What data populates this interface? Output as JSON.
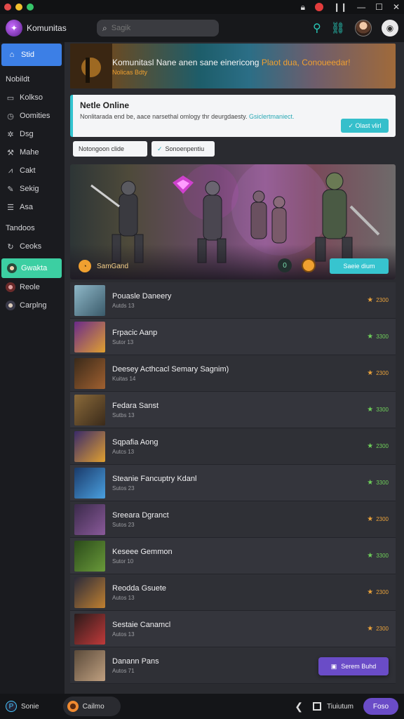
{
  "window": {
    "traffic_colors": [
      "#e24b4b",
      "#f2c02e",
      "#36c56a"
    ]
  },
  "header": {
    "app_title": "Komunitas",
    "search_placeholder": "Sagik"
  },
  "sidebar": {
    "active": "Stid",
    "section1": "Nobildt",
    "items1": [
      {
        "label": "Kolkso",
        "icon": "folder-icon",
        "glyph": "▭"
      },
      {
        "label": "Oomities",
        "icon": "clock-icon",
        "glyph": "◷"
      },
      {
        "label": "Dsg",
        "icon": "gear-icon",
        "glyph": "✲"
      },
      {
        "label": "Mahe",
        "icon": "wrench-icon",
        "glyph": "⚒"
      },
      {
        "label": "Cakt",
        "icon": "chart-icon",
        "glyph": "⩘"
      },
      {
        "label": "Sekig",
        "icon": "pen-icon",
        "glyph": "✎"
      },
      {
        "label": "Asa",
        "icon": "list-icon",
        "glyph": "☰"
      }
    ],
    "section2": "Tandoos",
    "items2": [
      {
        "label": "Ceoks",
        "icon": "refresh-icon",
        "glyph": "↻"
      }
    ],
    "active2": "Gwakta",
    "items3": [
      {
        "label": "Reole",
        "icon": "user-avatar-icon"
      },
      {
        "label": "Carplng",
        "icon": "user-avatar-icon"
      }
    ]
  },
  "banner": {
    "title_main": "Komunitasl Nane anen sane einericong ",
    "title_highlight": "Plaot dua, Conoueedar!",
    "subtitle": "Nolicas Bdty"
  },
  "notice": {
    "title": "Netle Online",
    "body": "Nonlitarada end be, aace narsethal omlogy thr deurgdaesty. ",
    "link": "Gsiclertmaniect.",
    "button": "✓ Olast vlirl"
  },
  "filters": {
    "f1": "Notongoon clide",
    "f2": "Sonoenpentiu"
  },
  "hero": {
    "left_label": "SamGand",
    "counter": "0",
    "button": "Saeie dium"
  },
  "list": [
    {
      "name": "Pouasle Daneery",
      "sub": "Autds 13",
      "score": "2300",
      "score_color": "#e9a23b"
    },
    {
      "name": "Frpacic Aanp",
      "sub": "Sutor 13",
      "score": "3300",
      "score_color": "#6fd05a"
    },
    {
      "name": "Deesey Acthcacl Semary Sagnim)",
      "sub": "Kuitas 14",
      "score": "2300",
      "score_color": "#e9a23b"
    },
    {
      "name": "Fedara Sanst",
      "sub": "Sutbs 13",
      "score": "3300",
      "score_color": "#6fd05a"
    },
    {
      "name": "Sqpafia Aong",
      "sub": "Autcs 13",
      "score": "2300",
      "score_color": "#6fd05a"
    },
    {
      "name": "Steanie Fancuptry Kdanl",
      "sub": "Sutos 23",
      "score": "3300",
      "score_color": "#6fd05a"
    },
    {
      "name": "Sreeara Dgranct",
      "sub": "Sutos 23",
      "score": "2300",
      "score_color": "#e9a23b"
    },
    {
      "name": "Keseee Gemmon",
      "sub": "Sutor 10",
      "score": "3300",
      "score_color": "#6fd05a"
    },
    {
      "name": "Reodda Gsuete",
      "sub": "Autos 13",
      "score": "2300",
      "score_color": "#e9a23b"
    },
    {
      "name": "Sestaie Canamcl",
      "sub": "Autos 13",
      "score": "2300",
      "score_color": "#e9a23b"
    },
    {
      "name": "Danann Pans",
      "sub": "Autos 71",
      "score": "",
      "score_color": "#e9a23b"
    }
  ],
  "float_button": "Serem Buhd",
  "bottom": {
    "left": "Sonie",
    "game": "Cailmo",
    "right_label": "Tiuiutum",
    "button": "Foso"
  }
}
